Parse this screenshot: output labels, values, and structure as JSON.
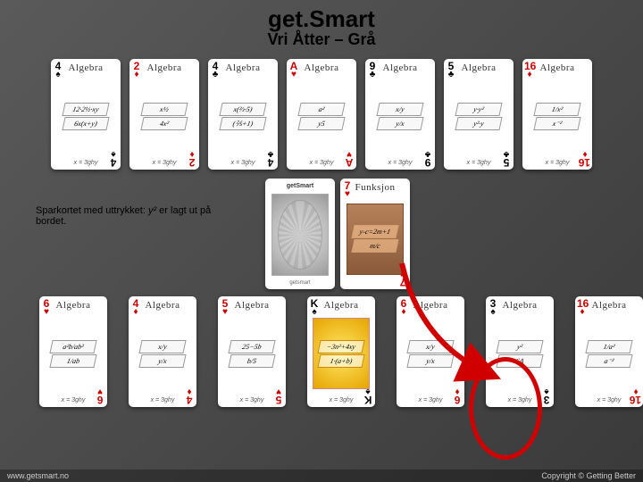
{
  "header": {
    "title": "get.Smart",
    "subtitle": "Vri Åtter – Grå"
  },
  "caption": {
    "text_pre": "Sparkortet med uttrykket: ",
    "expr": "y²",
    "text_post": " er lagt ut på bordet."
  },
  "cards": {
    "top": [
      {
        "rank": "4",
        "suit": "♠",
        "color": "black",
        "title": "Algebra",
        "exprs": [
          "12·2½·xy",
          "6x(x+y)"
        ],
        "foot": "x = 3ghy"
      },
      {
        "rank": "2",
        "suit": "♦",
        "color": "red",
        "title": "Algebra",
        "exprs": [
          "x½",
          "4x²"
        ],
        "foot": "x = 3ghy"
      },
      {
        "rank": "4",
        "suit": "♣",
        "color": "black",
        "title": "Algebra",
        "exprs": [
          "x(⅔·5)",
          "(⅖+1)"
        ],
        "foot": "x = 3ghy"
      },
      {
        "rank": "A",
        "suit": "♥",
        "color": "red",
        "title": "Algebra",
        "exprs": [
          "a²",
          "y5"
        ],
        "foot": "x = 3ghy"
      },
      {
        "rank": "9",
        "suit": "♣",
        "color": "black",
        "title": "Algebra",
        "exprs": [
          "x/y",
          "y/x"
        ],
        "foot": "x = 3ghy"
      },
      {
        "rank": "5",
        "suit": "♣",
        "color": "black",
        "title": "Algebra",
        "exprs": [
          "y·y²",
          "y²·y"
        ],
        "foot": "x = 3ghy"
      },
      {
        "rank": "16",
        "suit": "♦",
        "color": "red",
        "title": "Algebra",
        "exprs": [
          "1/x²",
          "x⁻²"
        ],
        "foot": "x = 3ghy"
      }
    ],
    "mid": [
      {
        "kind": "deck",
        "title": "getSmart",
        "foot": "getsmart"
      },
      {
        "kind": "funksjon",
        "rank": "7",
        "suit": "♥",
        "color": "red",
        "title": "Funksjon",
        "exprs": [
          "y-c=2m+1",
          "m/c"
        ],
        "foot": ""
      }
    ],
    "bot": [
      {
        "rank": "6",
        "suit": "♥",
        "color": "red",
        "title": "Algebra",
        "exprs": [
          "a²b/ab²",
          "1/ab"
        ],
        "foot": "x = 3ghy"
      },
      {
        "rank": "4",
        "suit": "♦",
        "color": "red",
        "title": "Algebra",
        "exprs": [
          "x/y",
          "y/x"
        ],
        "foot": "x = 3ghy"
      },
      {
        "rank": "5",
        "suit": "♥",
        "color": "red",
        "title": "Algebra",
        "exprs": [
          "25−5b",
          "b/5"
        ],
        "foot": "x = 3ghy"
      },
      {
        "kind": "wild",
        "rank": "K",
        "suit": "♠",
        "color": "black",
        "title": "Algebra",
        "exprs": [
          "−3n²+4xy",
          "1·(a+b)"
        ],
        "foot": "x = 3ghy"
      },
      {
        "rank": "6",
        "suit": "♦",
        "color": "red",
        "title": "Algebra",
        "exprs": [
          "x/y",
          "y/x"
        ],
        "foot": "x = 3ghy"
      },
      {
        "rank": "3",
        "suit": "♠",
        "color": "black",
        "title": "Algebra",
        "exprs": [
          "y²",
          "6A"
        ],
        "foot": "x = 3ghy"
      },
      {
        "rank": "16",
        "suit": "♦",
        "color": "red",
        "title": "Algebra",
        "exprs": [
          "1/a²",
          "a⁻²"
        ],
        "foot": "x = 3ghy"
      }
    ]
  },
  "footer": {
    "left": "www.getsmart.no",
    "right": "Copyright © Getting Better"
  }
}
